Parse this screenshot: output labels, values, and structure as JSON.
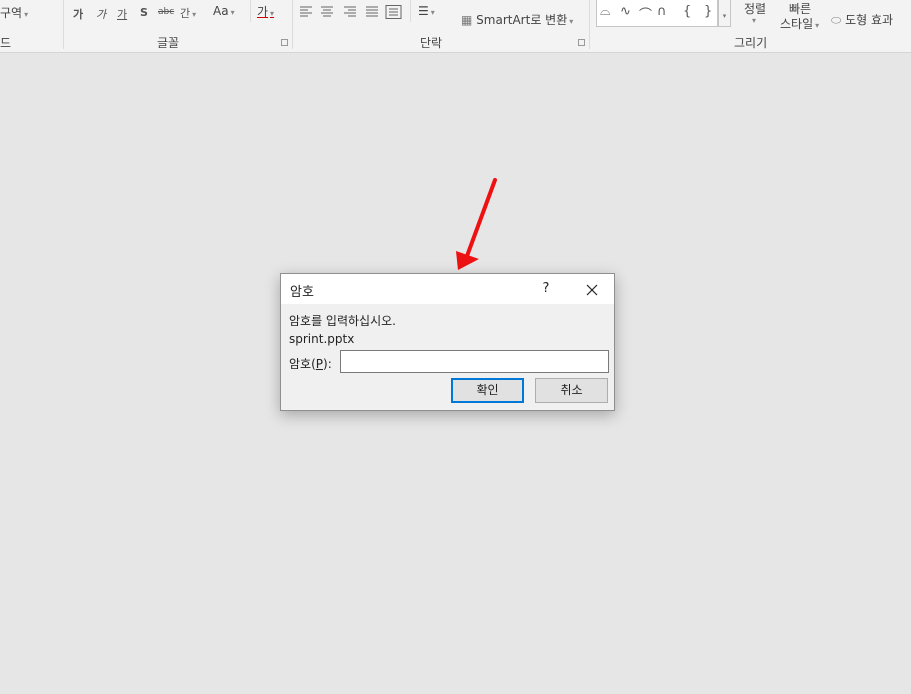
{
  "ribbon": {
    "section_partial_label": "구역",
    "section_edge_label": "드",
    "groups": {
      "font_label": "글꼴",
      "paragraph_label": "단락",
      "drawing_label": "그리기"
    },
    "font_buttons": [
      "가",
      "가",
      "가",
      "S",
      "abc",
      "간",
      "Aa",
      "가"
    ],
    "smartart_label": "SmartArt로 변환",
    "arrange_label": "정렬",
    "quick_styles_label_1": "빠른",
    "quick_styles_label_2": "스타일",
    "shape_effects_label": "도형 효과"
  },
  "dialog": {
    "title": "암호",
    "help_label": "?",
    "message": "암호를 입력하십시오.",
    "filename": "sprint.pptx",
    "password_label_prefix": "암호(",
    "password_label_key": "P",
    "password_label_suffix": "):",
    "password_value": "",
    "ok_label": "확인",
    "cancel_label": "취소"
  },
  "colors": {
    "arrow": "#ee1111",
    "ok_border": "#0078d7",
    "workspace": "#e6e6e6"
  }
}
